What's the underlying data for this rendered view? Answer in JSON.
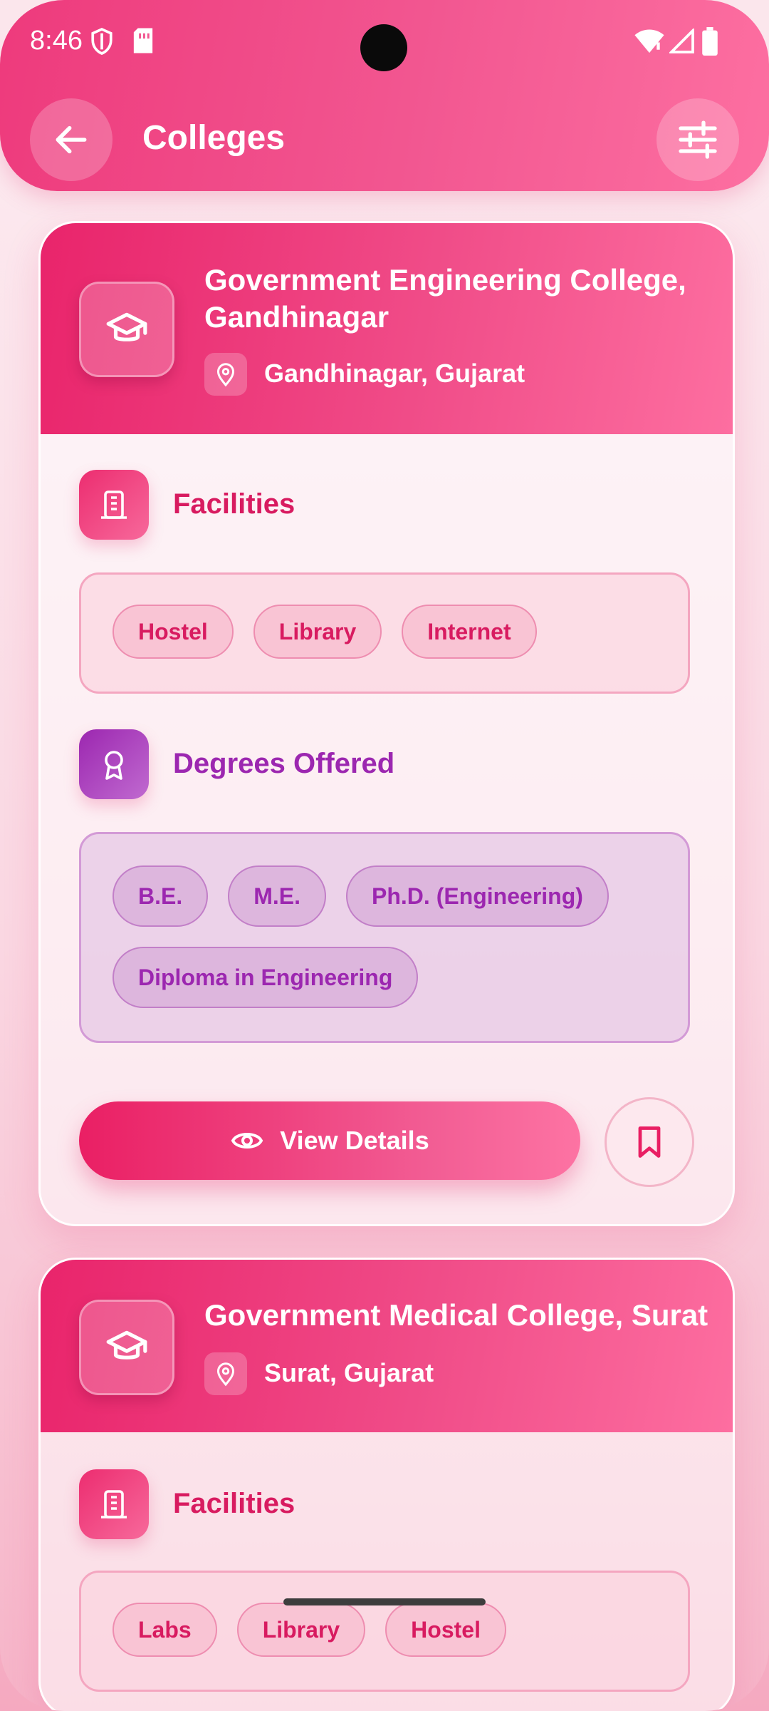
{
  "status_bar": {
    "time": "8:46"
  },
  "header": {
    "title": "Colleges"
  },
  "colleges": [
    {
      "name_line1": "Government Engineering College,",
      "name_line2": "Gandhinagar",
      "location": "Gandhinagar, Gujarat",
      "facilities_title": "Facilities",
      "facilities": [
        "Hostel",
        "Library",
        "Internet"
      ],
      "degrees_title": "Degrees Offered",
      "degrees": [
        "B.E.",
        "M.E.",
        "Ph.D. (Engineering)",
        "Diploma in Engineering"
      ],
      "view_label": "View Details"
    },
    {
      "name_line1": "Government Medical College, Surat",
      "location": "Surat, Gujarat",
      "facilities_title": "Facilities",
      "facilities": [
        "Labs",
        "Library",
        "Hostel"
      ]
    }
  ],
  "colors": {
    "primary": "#e91e63",
    "purple": "#9c27b0"
  },
  "icons": [
    "back-arrow-icon",
    "filter-sliders-icon",
    "graduation-cap-icon",
    "location-pin-icon",
    "building-icon",
    "award-badge-icon",
    "eye-icon",
    "bookmark-icon"
  ]
}
